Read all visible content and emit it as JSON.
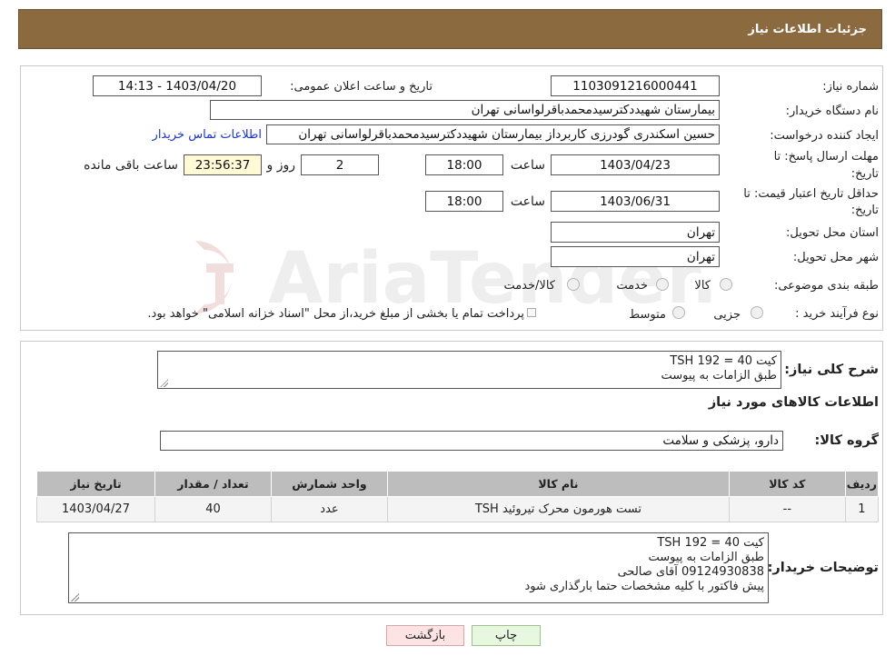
{
  "header": {
    "title": "جزئیات اطلاعات نیاز"
  },
  "form": {
    "need_number_label": "شماره نیاز:",
    "need_number": "1103091216000441",
    "announce_label": "تاریخ و ساعت اعلان عمومی:",
    "announce_value": "1403/04/20 - 14:13",
    "buyer_org_label": "نام دستگاه خریدار:",
    "buyer_org": "بیمارستان شهیددکترسیدمحمدباقرلواسانی تهران",
    "creator_label": "ایجاد کننده درخواست:",
    "creator": "حسین اسکندری گودرزی کاربرداز بیمارستان شهیددکترسیدمحمدباقرلواسانی تهران",
    "buyer_contact_link": "اطلاعات تماس خریدار",
    "reply_deadline_label_1": "مهلت ارسال پاسخ: تا",
    "reply_deadline_label_2": "تاریخ:",
    "reply_date": "1403/04/23",
    "time_label": "ساعت",
    "reply_time": "18:00",
    "days_value": "2",
    "days_label": "روز و",
    "remaining_time": "23:56:37",
    "remaining_label": "ساعت باقی مانده",
    "validity_label_1": "حداقل تاریخ اعتبار قیمت: تا",
    "validity_label_2": "تاریخ:",
    "validity_date": "1403/06/31",
    "validity_time": "18:00",
    "province_label": "استان محل تحویل:",
    "province": "تهران",
    "city_label": "شهر محل تحویل:",
    "city": "تهران",
    "category_label": "طبقه بندی موضوعی:",
    "category_options": [
      "کالا",
      "خدمت",
      "کالا/خدمت"
    ],
    "process_label": "نوع فرآیند خرید :",
    "process_options": [
      "جزیی",
      "متوسط"
    ],
    "process_note": "پرداخت تمام یا بخشی از مبلغ خرید،از محل \"اسناد خزانه اسلامی\" خواهد بود."
  },
  "summary": {
    "general_desc_label": "شرح کلی نیاز:",
    "general_desc_lines": [
      "کیت 40 = TSH 192",
      "طبق الزامات به پیوست"
    ],
    "goods_info_title": "اطلاعات کالاهای مورد نیاز",
    "goods_group_label": "گروه کالا:",
    "goods_group": "دارو، پزشکی و سلامت"
  },
  "table": {
    "headers": [
      "ردیف",
      "کد کالا",
      "نام کالا",
      "واحد شمارش",
      "تعداد / مقدار",
      "تاریخ نیاز"
    ],
    "rows": [
      [
        "1",
        "--",
        "تست هورمون محرک تیروئید TSH",
        "عدد",
        "40",
        "1403/04/27"
      ]
    ]
  },
  "buyer_notes": {
    "label": "توضیحات خریدار:",
    "lines": [
      "کیت 40 = TSH 192",
      "طبق الزامات به پیوست",
      "09124930838 آقای صالحی",
      "پیش فاکتور با کلیه مشخصات حتما بارگذاری شود"
    ]
  },
  "buttons": {
    "print": "چاپ",
    "back": "بازگشت"
  },
  "watermark": {
    "text": "AriaTender.neT"
  },
  "colors": {
    "header_bg": "#8c6a3f",
    "link": "#1a35c9",
    "back_button_bg": "#fde3e3",
    "print_button_bg": "#e8f7e0"
  }
}
